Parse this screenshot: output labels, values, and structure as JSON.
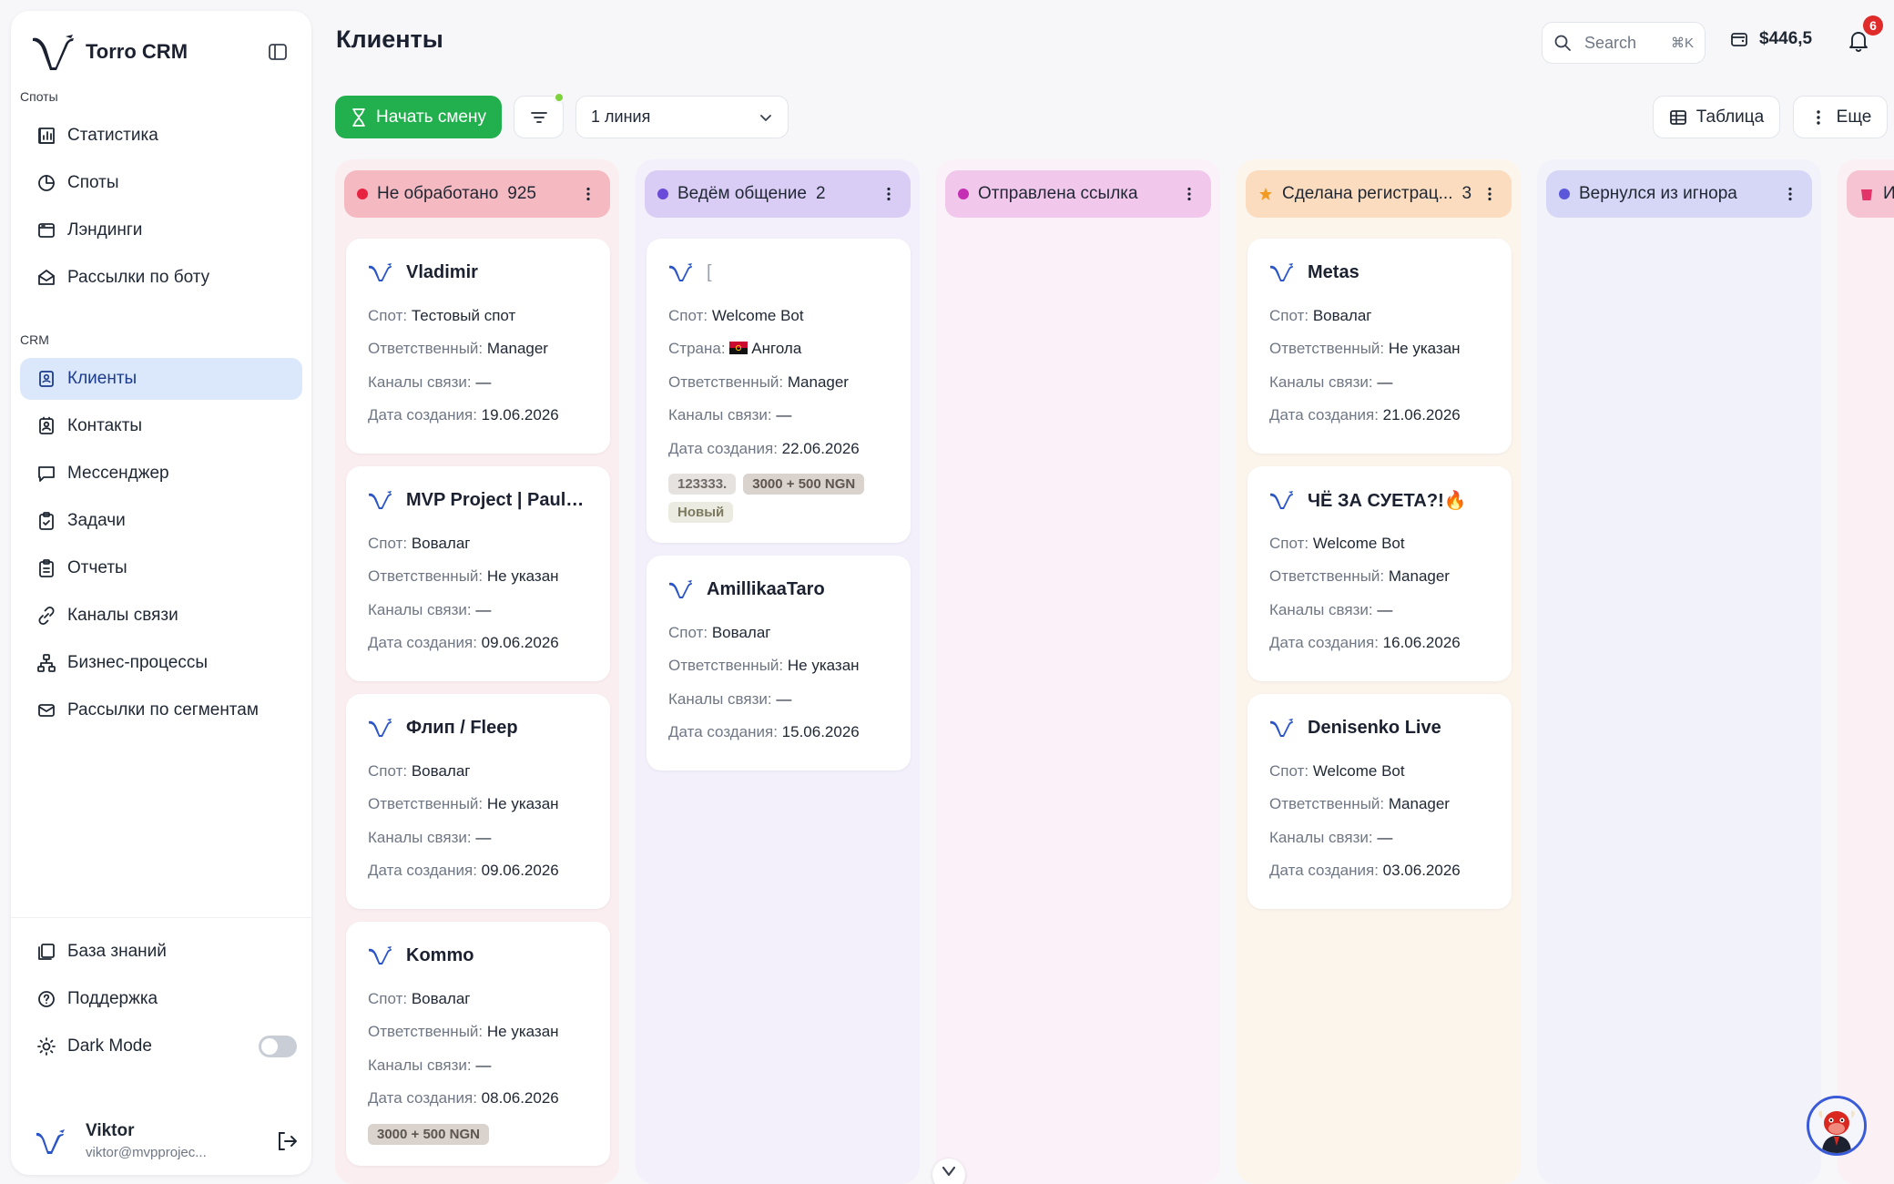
{
  "app": {
    "name": "Torro CRM"
  },
  "page": {
    "title": "Клиенты"
  },
  "sidebar": {
    "section_spots": "Споты",
    "section_crm": "CRM",
    "spots_items": [
      {
        "label": "Статистика",
        "icon": "bar-chart-icon"
      },
      {
        "label": "Споты",
        "icon": "pie-chart-icon"
      },
      {
        "label": "Лэндинги",
        "icon": "browser-window-icon"
      },
      {
        "label": "Рассылки по боту",
        "icon": "envelope-open-icon"
      }
    ],
    "crm_items": [
      {
        "label": "Клиенты",
        "icon": "contact-card-icon",
        "active": true
      },
      {
        "label": "Контакты",
        "icon": "address-book-icon"
      },
      {
        "label": "Мессенджер",
        "icon": "chat-bubble-icon"
      },
      {
        "label": "Задачи",
        "icon": "clipboard-check-icon"
      },
      {
        "label": "Отчеты",
        "icon": "clipboard-list-icon"
      },
      {
        "label": "Каналы связи",
        "icon": "link-icon"
      },
      {
        "label": "Бизнес-процессы",
        "icon": "flow-icon"
      },
      {
        "label": "Рассылки по сегментам",
        "icon": "mail-icon"
      }
    ],
    "bottom_items": [
      {
        "label": "База знаний",
        "icon": "book-icon"
      },
      {
        "label": "Поддержка",
        "icon": "help-circle-icon"
      },
      {
        "label": "Dark Mode",
        "icon": "sun-icon",
        "toggle": false
      }
    ],
    "user": {
      "name": "Viktor",
      "email": "viktor@mvpprojec..."
    }
  },
  "header": {
    "search_placeholder": "Search",
    "search_shortcut": "⌘K",
    "balance": "$446,5",
    "notifications_count": "6"
  },
  "toolbar": {
    "start_shift": "Начать смену",
    "line_select": "1 линия",
    "table_view": "Таблица",
    "more": "Еще"
  },
  "columns": [
    {
      "title": "Не обработано",
      "count": "925",
      "color": "#f5b9c2",
      "bg": "#fbeef0",
      "dot": "#e8233f",
      "cards": [
        {
          "name": "Vladimir",
          "fields": [
            [
              "Спот:",
              "Тестовый спот"
            ],
            [
              "Ответственный:",
              "Manager"
            ],
            [
              "Каналы связи:",
              "—"
            ],
            [
              "Дата создания:",
              "19.06.2026"
            ]
          ],
          "tags": []
        },
        {
          "name": "MVP Project | Paula...",
          "fields": [
            [
              "Спот:",
              "Вовалаг"
            ],
            [
              "Ответственный:",
              "Не указан"
            ],
            [
              "Каналы связи:",
              "—"
            ],
            [
              "Дата создания:",
              "09.06.2026"
            ]
          ],
          "tags": []
        },
        {
          "name": "Флип / Fleep",
          "fields": [
            [
              "Спот:",
              "Вовалаг"
            ],
            [
              "Ответственный:",
              "Не указан"
            ],
            [
              "Каналы связи:",
              "—"
            ],
            [
              "Дата создания:",
              "09.06.2026"
            ]
          ],
          "tags": []
        },
        {
          "name": "Kommo",
          "fields": [
            [
              "Спот:",
              "Вовалаг"
            ],
            [
              "Ответственный:",
              "Не указан"
            ],
            [
              "Каналы связи:",
              "—"
            ],
            [
              "Дата создания:",
              "08.06.2026"
            ]
          ],
          "tags": [
            "3000 + 500 NGN"
          ]
        }
      ]
    },
    {
      "title": "Ведём общение",
      "count": "2",
      "color": "#d9cdf5",
      "bg": "#f3f0fb",
      "dot": "#6a4ad8",
      "cards": [
        {
          "name": "[",
          "faint": true,
          "fields": [
            [
              "Спот:",
              "Welcome Bot"
            ],
            [
              "Страна:",
              "Ангола"
            ],
            [
              "Ответственный:",
              "Manager"
            ],
            [
              "Каналы связи:",
              "—"
            ],
            [
              "Дата создания:",
              "22.06.2026"
            ]
          ],
          "tags": [
            "123333.",
            "3000 + 500 NGN",
            "Новый"
          ]
        },
        {
          "name": "AmillikaaTaro",
          "fields": [
            [
              "Спот:",
              "Вовалаг"
            ],
            [
              "Ответственный:",
              "Не указан"
            ],
            [
              "Каналы связи:",
              "—"
            ],
            [
              "Дата создания:",
              "15.06.2026"
            ]
          ],
          "tags": []
        }
      ]
    },
    {
      "title": "Отправлена ссылка",
      "count": "",
      "color": "#f2c7ec",
      "bg": "#fbf2f9",
      "dot": "#c52fb4",
      "cards": []
    },
    {
      "title": "Сделана регистрац...",
      "count": "3",
      "color": "#fbdcbf",
      "bg": "#fcf5ec",
      "dot": "#f39a22",
      "star": true,
      "cards": [
        {
          "name": "Metas",
          "fields": [
            [
              "Спот:",
              "Вовалаг"
            ],
            [
              "Ответственный:",
              "Не указан"
            ],
            [
              "Каналы связи:",
              "—"
            ],
            [
              "Дата создания:",
              "21.06.2026"
            ]
          ],
          "tags": []
        },
        {
          "name": "ЧЁ ЗА СУЕТА?!🔥",
          "fields": [
            [
              "Спот:",
              "Welcome Bot"
            ],
            [
              "Ответственный:",
              "Manager"
            ],
            [
              "Каналы связи:",
              "—"
            ],
            [
              "Дата создания:",
              "16.06.2026"
            ]
          ],
          "tags": []
        },
        {
          "name": "Denisenko Live",
          "fields": [
            [
              "Спот:",
              "Welcome Bot"
            ],
            [
              "Ответственный:",
              "Manager"
            ],
            [
              "Каналы связи:",
              "—"
            ],
            [
              "Дата создания:",
              "03.06.2026"
            ]
          ],
          "tags": []
        }
      ]
    },
    {
      "title": "Вернулся из игнора",
      "count": "",
      "color": "#d6d6f6",
      "bg": "#f2f2fb",
      "dot": "#5b57d9",
      "cards": []
    },
    {
      "title": "Иг",
      "count": "",
      "color": "#f5c3d2",
      "bg": "#fbf0f4",
      "dot": "#e23468",
      "cards": [],
      "partial": true
    }
  ]
}
